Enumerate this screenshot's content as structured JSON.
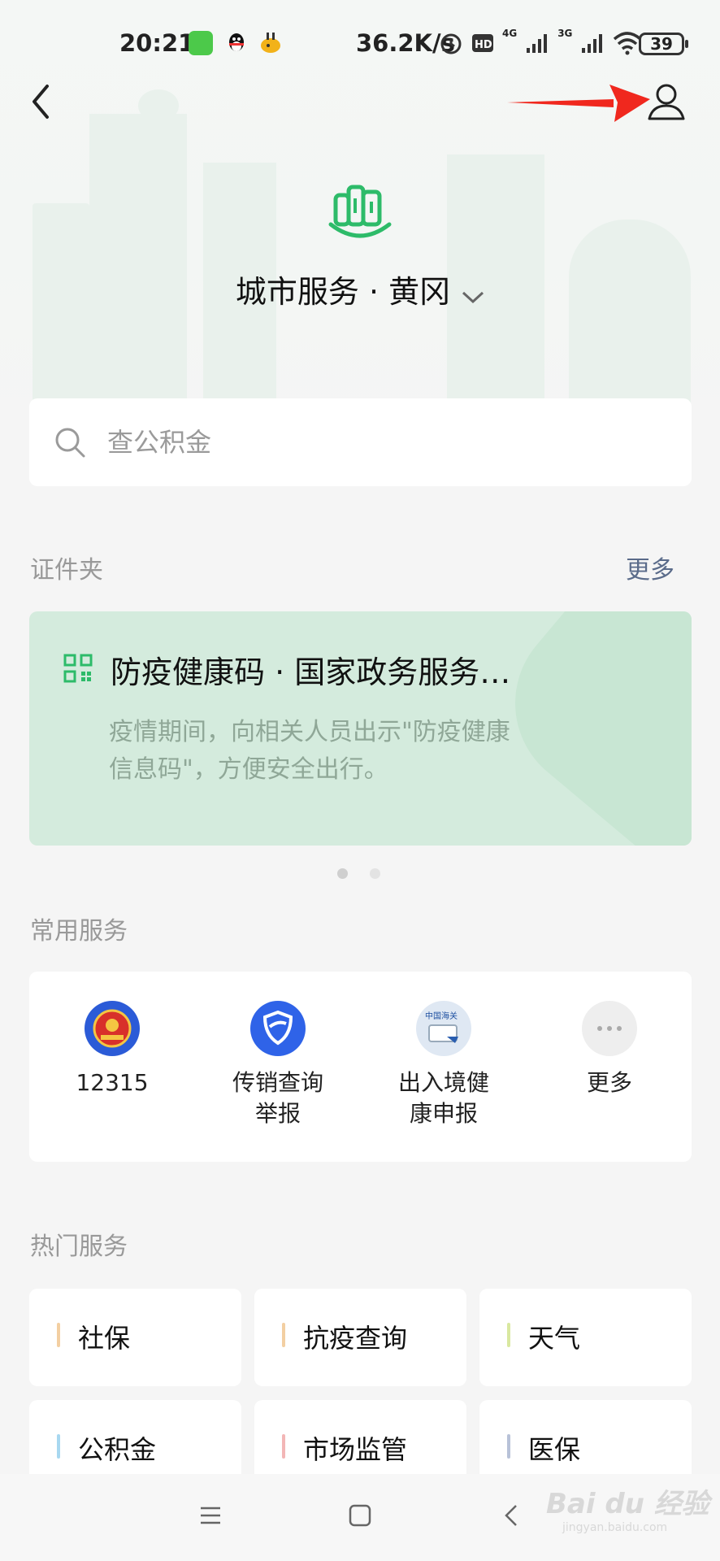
{
  "status_bar": {
    "time": "20:21",
    "net_speed": "36.2K/s",
    "network_4g": "4G",
    "network_3g": "3G",
    "battery": "39"
  },
  "header": {
    "city_title": "城市服务 · 黄冈"
  },
  "search": {
    "placeholder": "查公积金"
  },
  "credentials": {
    "title": "证件夹",
    "more_label": "更多",
    "card": {
      "title": "防疫健康码 · 国家政务服务…",
      "desc": "疫情期间，向相关人员出示\"防疫健康信息码\"，方便安全出行。"
    }
  },
  "common_services": {
    "title": "常用服务",
    "items": [
      {
        "label": "12315",
        "icon": "national-emblem-icon",
        "color": "#2b5bd7"
      },
      {
        "label": "传销查询\n举报",
        "icon": "shield-icon",
        "color": "#2f63e8"
      },
      {
        "label": "出入境健\n康申报",
        "icon": "customs-icon",
        "color": "#dfe8f3",
        "icon_text": "中国海关"
      },
      {
        "label": "更多",
        "icon": "more-dots-icon",
        "color": "#eeeeee"
      }
    ]
  },
  "hot_services": {
    "title": "热门服务",
    "items": [
      {
        "label": "社保",
        "bar_color": "#f3cfa2"
      },
      {
        "label": "抗疫查询",
        "bar_color": "#f3cfa2"
      },
      {
        "label": "天气",
        "bar_color": "#d9e8a0"
      },
      {
        "label": "公积金",
        "bar_color": "#a8d8f0"
      },
      {
        "label": "市场监管",
        "bar_color": "#f3b6b6"
      },
      {
        "label": "医保",
        "bar_color": "#b8c2d8"
      }
    ]
  },
  "watermark": {
    "brand": "Bai du 经验",
    "url": "jingyan.baidu.com"
  },
  "colors": {
    "accent_green": "#2dbb69",
    "card_bg": "#d4ebdd",
    "annotation_arrow": "#f0281e"
  }
}
